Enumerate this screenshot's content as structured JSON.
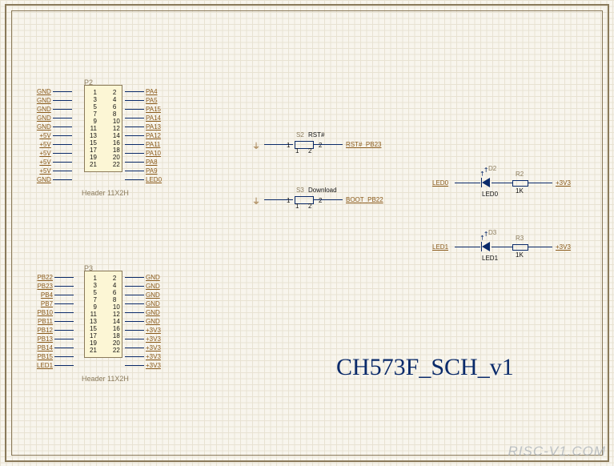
{
  "title": "CH573F_SCH_v1",
  "watermark": "RISC-V1.COM",
  "header_p2": {
    "ref": "P2",
    "caption": "Header 11X2H",
    "pins": [
      [
        1,
        2
      ],
      [
        3,
        4
      ],
      [
        5,
        6
      ],
      [
        7,
        8
      ],
      [
        9,
        10
      ],
      [
        11,
        12
      ],
      [
        13,
        14
      ],
      [
        15,
        16
      ],
      [
        17,
        18
      ],
      [
        19,
        20
      ],
      [
        21,
        22
      ]
    ],
    "left": [
      "GND",
      "GND",
      "GND",
      "GND",
      "GND",
      "+5V",
      "+5V",
      "+5V",
      "+5V",
      "+5V",
      "GND"
    ],
    "right": [
      "PA4",
      "PA5",
      "PA15",
      "PA14",
      "PA13",
      "PA12",
      "PA11",
      "PA10",
      "PA8",
      "PA9",
      "LED0"
    ]
  },
  "header_p3": {
    "ref": "P3",
    "caption": "Header 11X2H",
    "pins": [
      [
        1,
        2
      ],
      [
        3,
        4
      ],
      [
        5,
        6
      ],
      [
        7,
        8
      ],
      [
        9,
        10
      ],
      [
        11,
        12
      ],
      [
        13,
        14
      ],
      [
        15,
        16
      ],
      [
        17,
        18
      ],
      [
        19,
        20
      ],
      [
        21,
        22
      ]
    ],
    "left": [
      "PB22",
      "PB23",
      "PB4",
      "PB7",
      "PB10",
      "PB11",
      "PB12",
      "PB13",
      "PB14",
      "PB15",
      "LED1"
    ],
    "right": [
      "GND",
      "GND",
      "GND",
      "GND",
      "GND",
      "GND",
      "+3V3",
      "+3V3",
      "+3V3",
      "+3V3",
      "+3V3"
    ]
  },
  "switches": {
    "s2": {
      "ref": "S2",
      "name": "RST#",
      "pins": [
        "1",
        "2"
      ],
      "pin_inner": [
        "1",
        "2"
      ],
      "net": "RST#_PB23"
    },
    "s3": {
      "ref": "S3",
      "name": "Download",
      "pins": [
        "1",
        "2"
      ],
      "pin_inner": [
        "1",
        "2"
      ],
      "net": "BOOT_PB22"
    }
  },
  "leds": {
    "d2": {
      "ref": "D2",
      "name": "LED0",
      "net_in": "LED0",
      "res_ref": "R2",
      "res_val": "1K",
      "net_out": "+3V3"
    },
    "d3": {
      "ref": "D3",
      "name": "LED1",
      "net_in": "LED1",
      "res_ref": "R3",
      "res_val": "1K",
      "net_out": "+3V3"
    }
  },
  "chart_data": null
}
